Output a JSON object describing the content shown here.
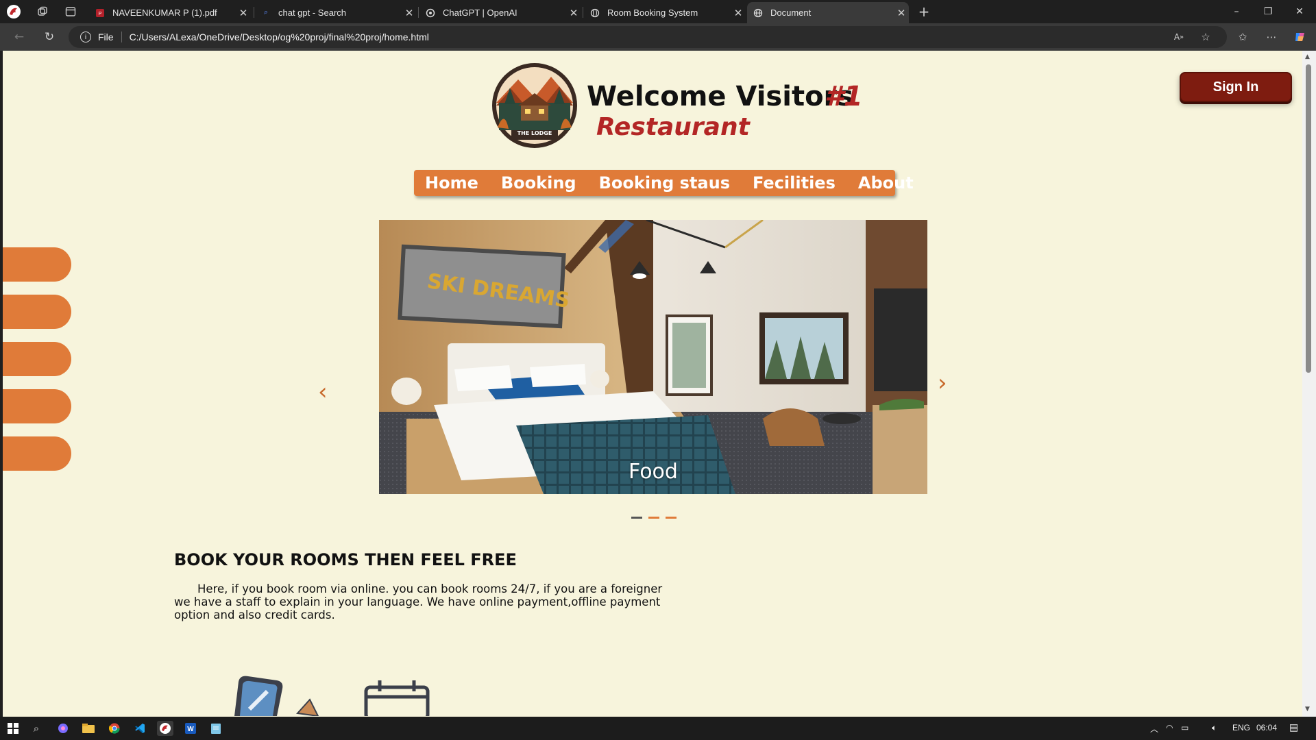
{
  "browser": {
    "tabs": [
      {
        "title": "NAVEENKUMAR P (1).pdf",
        "icon": "pdf-icon"
      },
      {
        "title": "chat gpt - Search",
        "icon": "search-icon"
      },
      {
        "title": "ChatGPT | OpenAI",
        "icon": "openai-icon"
      },
      {
        "title": "Room Booking System",
        "icon": "globe-icon"
      },
      {
        "title": "Document",
        "icon": "globe-icon"
      }
    ],
    "active_tab": 4,
    "address": {
      "scheme_label": "File",
      "url": "C:/Users/ALexa/OneDrive/Desktop/og%20proj/final%20proj/home.html"
    }
  },
  "page": {
    "logo_text": "THE LODGE",
    "title": "Welcome Visitors",
    "badge": "#1",
    "subtitle": "Restaurant",
    "signin_label": "Sign In",
    "nav": [
      "Home",
      "Booking",
      "Booking staus",
      "Fecilities",
      "About"
    ],
    "carousel": {
      "caption": "Food",
      "sign_text": "SKI DREAMS",
      "prev": "‹",
      "next": "›",
      "slides": 3,
      "active_slide": 0
    },
    "heading": "BOOK YOUR ROOMS THEN FEEL FREE",
    "paragraph": "Here, if you book room via online. you can book rooms 24/7, if you are a foreigner we have a staff to explain in your language. We have online payment,offline payment option and also credit cards."
  },
  "taskbar": {
    "language": "ENG",
    "time": "06:04"
  },
  "colors": {
    "page_bg": "#f7f4dc",
    "accent_orange": "#e07b39",
    "brand_red": "#b32625",
    "signin_bg": "#7e1c10"
  }
}
